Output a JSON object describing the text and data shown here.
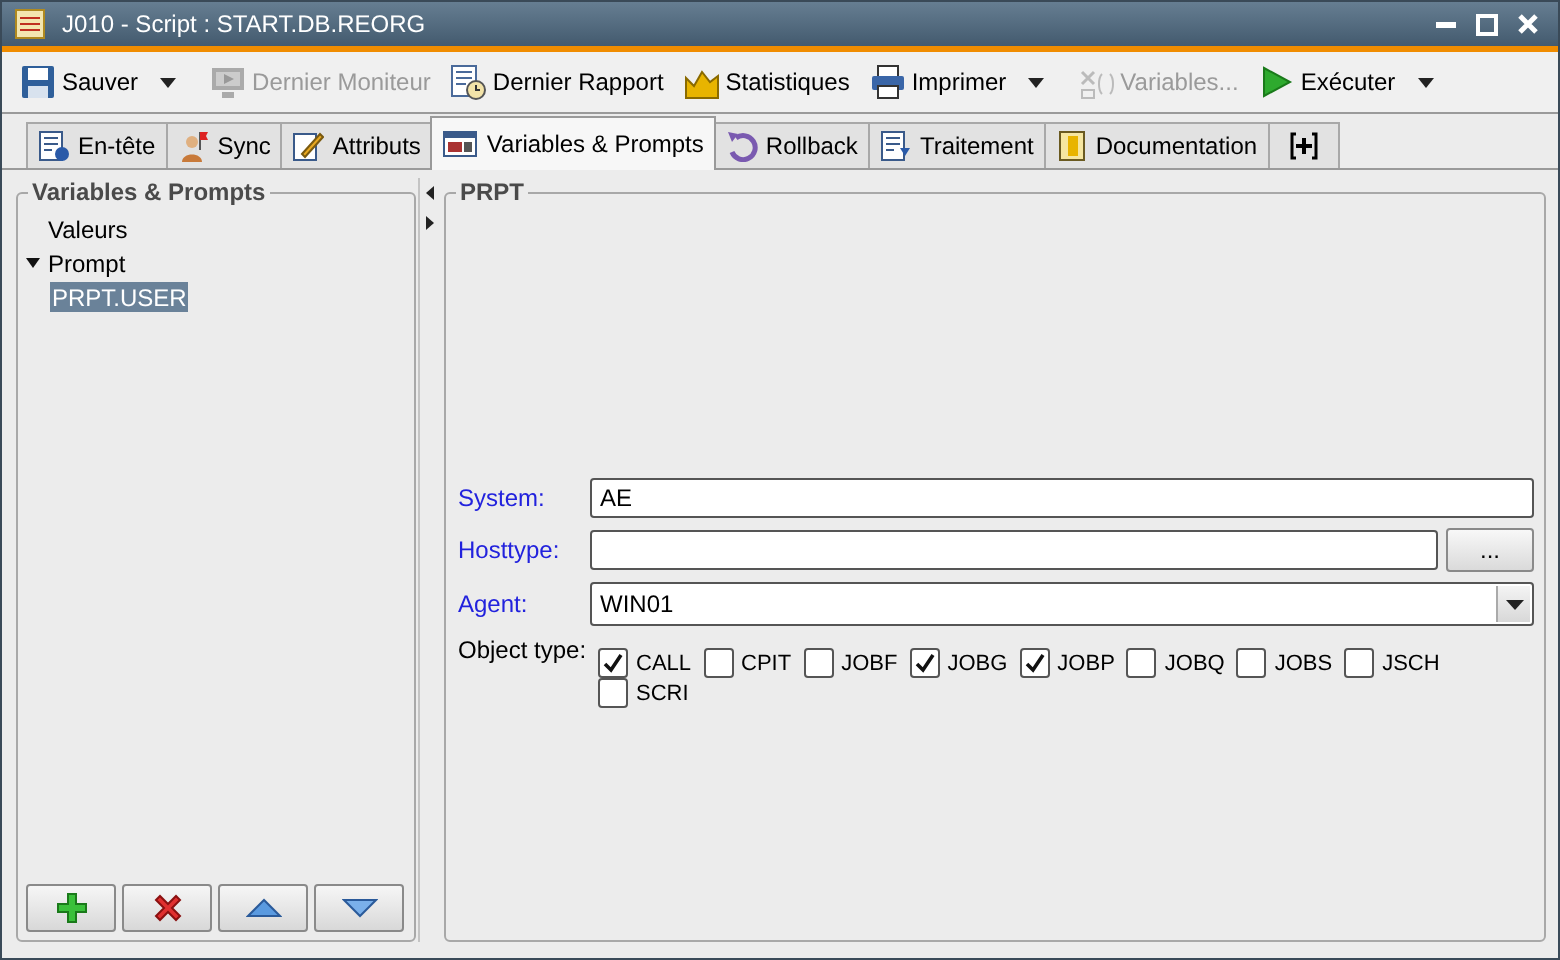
{
  "window": {
    "title": "J010 - Script : START.DB.REORG"
  },
  "toolbar": [
    {
      "label": "Sauver",
      "disabled": false,
      "dropdown": true
    },
    {
      "label": "Dernier Moniteur",
      "disabled": true,
      "dropdown": false
    },
    {
      "label": "Dernier Rapport",
      "disabled": false,
      "dropdown": false
    },
    {
      "label": "Statistiques",
      "disabled": false,
      "dropdown": false
    },
    {
      "label": "Imprimer",
      "disabled": false,
      "dropdown": true
    },
    {
      "label": "Variables...",
      "disabled": true,
      "dropdown": false
    },
    {
      "label": "Exécuter",
      "disabled": false,
      "dropdown": true
    }
  ],
  "tabs": [
    {
      "label": "En-tête",
      "selected": false
    },
    {
      "label": "Sync",
      "selected": false
    },
    {
      "label": "Attributs",
      "selected": false
    },
    {
      "label": "Variables & Prompts",
      "selected": true
    },
    {
      "label": "Rollback",
      "selected": false
    },
    {
      "label": "Traitement",
      "selected": false
    },
    {
      "label": "Documentation",
      "selected": false
    },
    {
      "kind": "add",
      "selected": false
    }
  ],
  "sidebar": {
    "title": "Variables & Prompts",
    "items": [
      {
        "label": "Valeurs",
        "selected": false
      },
      {
        "label": "Prompt",
        "selected": false,
        "expanded": true,
        "children": [
          {
            "label": "PRPT.USER",
            "selected": true
          }
        ]
      }
    ]
  },
  "form": {
    "title": "PRPT",
    "fields": [
      {
        "kind": "text",
        "label": "System:",
        "required": true,
        "value": "AE"
      },
      {
        "kind": "browse",
        "label": "Hosttype:",
        "required": true,
        "button_label": "..."
      },
      {
        "kind": "combo",
        "label": "Agent:",
        "required": true,
        "value": "WIN01"
      }
    ],
    "object_type": {
      "label": "Object type:",
      "options": [
        {
          "label": "CALL",
          "checked": true
        },
        {
          "label": "CPIT",
          "checked": false
        },
        {
          "label": "JOBF",
          "checked": false
        },
        {
          "label": "JOBG",
          "checked": true
        },
        {
          "label": "JOBP",
          "checked": true
        },
        {
          "label": "JOBQ",
          "checked": false
        },
        {
          "label": "JOBS",
          "checked": false
        },
        {
          "label": "JSCH",
          "checked": false
        },
        {
          "label": "SCRI",
          "checked": false
        }
      ]
    }
  }
}
